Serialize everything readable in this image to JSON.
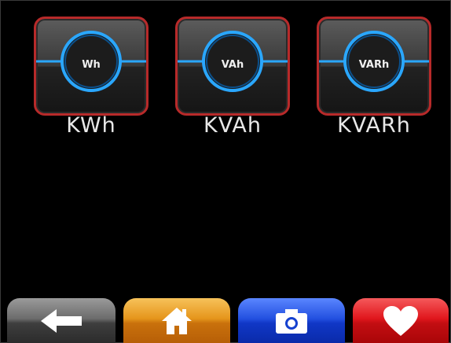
{
  "meters": [
    {
      "icon_label": "Wh",
      "caption": "KWh"
    },
    {
      "icon_label": "VAh",
      "caption": "KVAh"
    },
    {
      "icon_label": "VARh",
      "caption": "KVARh"
    }
  ],
  "nav": [
    {
      "icon": "back-arrow-icon"
    },
    {
      "icon": "home-icon"
    },
    {
      "icon": "camera-icon"
    },
    {
      "icon": "heart-icon"
    }
  ],
  "colors": {
    "tile_border": "#b72a2a",
    "ring": "#2aa7ff",
    "back": "#6c6c6c",
    "home": "#e5951b",
    "camera": "#2350e0",
    "favorite": "#e0161c"
  }
}
